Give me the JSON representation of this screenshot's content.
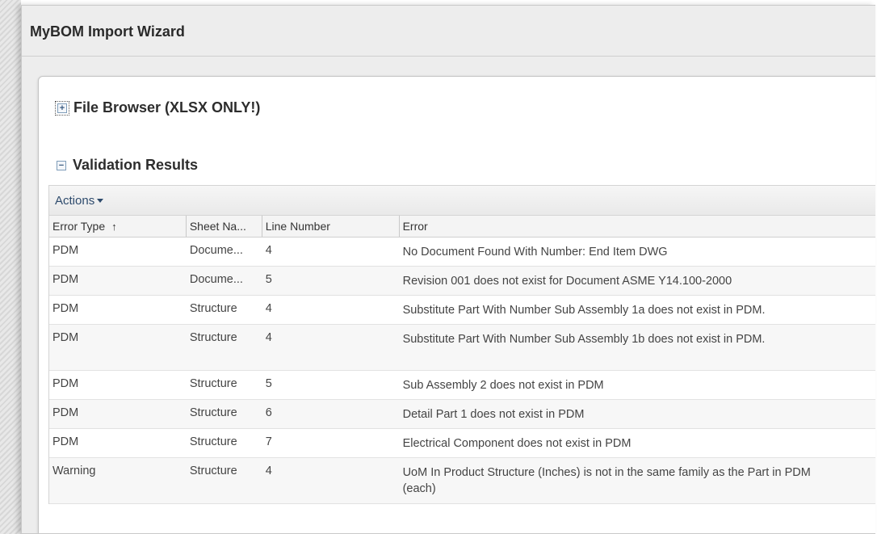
{
  "window": {
    "title": "MyBOM Import Wizard"
  },
  "sections": {
    "file_browser": {
      "label": "File Browser (XLSX ONLY!)",
      "expander": "+"
    },
    "validation": {
      "label": "Validation Results",
      "expander": "−"
    }
  },
  "grid": {
    "actions_label": "Actions",
    "sort_indicator": "↑",
    "columns": [
      "Error Type",
      "Sheet Na...",
      "Line Number",
      "Error"
    ],
    "rows": [
      {
        "type": "PDM",
        "sheet": "Docume...",
        "line": "4",
        "error": "No Document Found With Number: End Item DWG"
      },
      {
        "type": "PDM",
        "sheet": "Docume...",
        "line": "5",
        "error": "Revision 001 does not exist for Document ASME Y14.100-2000"
      },
      {
        "type": "PDM",
        "sheet": "Structure",
        "line": "4",
        "error": "Substitute Part With Number Sub Assembly 1a does not exist in PDM."
      },
      {
        "type": "PDM",
        "sheet": "Structure",
        "line": "4",
        "error": "Substitute Part With Number  Sub Assembly 1b does not exist in PDM."
      },
      {
        "type": "PDM",
        "sheet": "Structure",
        "line": "5",
        "error": "Sub Assembly 2 does not exist in PDM"
      },
      {
        "type": "PDM",
        "sheet": "Structure",
        "line": "6",
        "error": "Detail Part 1 does not exist in PDM"
      },
      {
        "type": "PDM",
        "sheet": "Structure",
        "line": "7",
        "error": "Electrical Component does not exist in PDM"
      },
      {
        "type": "Warning",
        "sheet": "Structure",
        "line": "4",
        "error": "UoM In Product Structure (Inches) is not in the same family as the Part in PDM (each)"
      }
    ]
  },
  "colors": {
    "accent": "#2d4a6c",
    "window_bg": "#ededed",
    "grid_header": "#f4f4f4"
  }
}
